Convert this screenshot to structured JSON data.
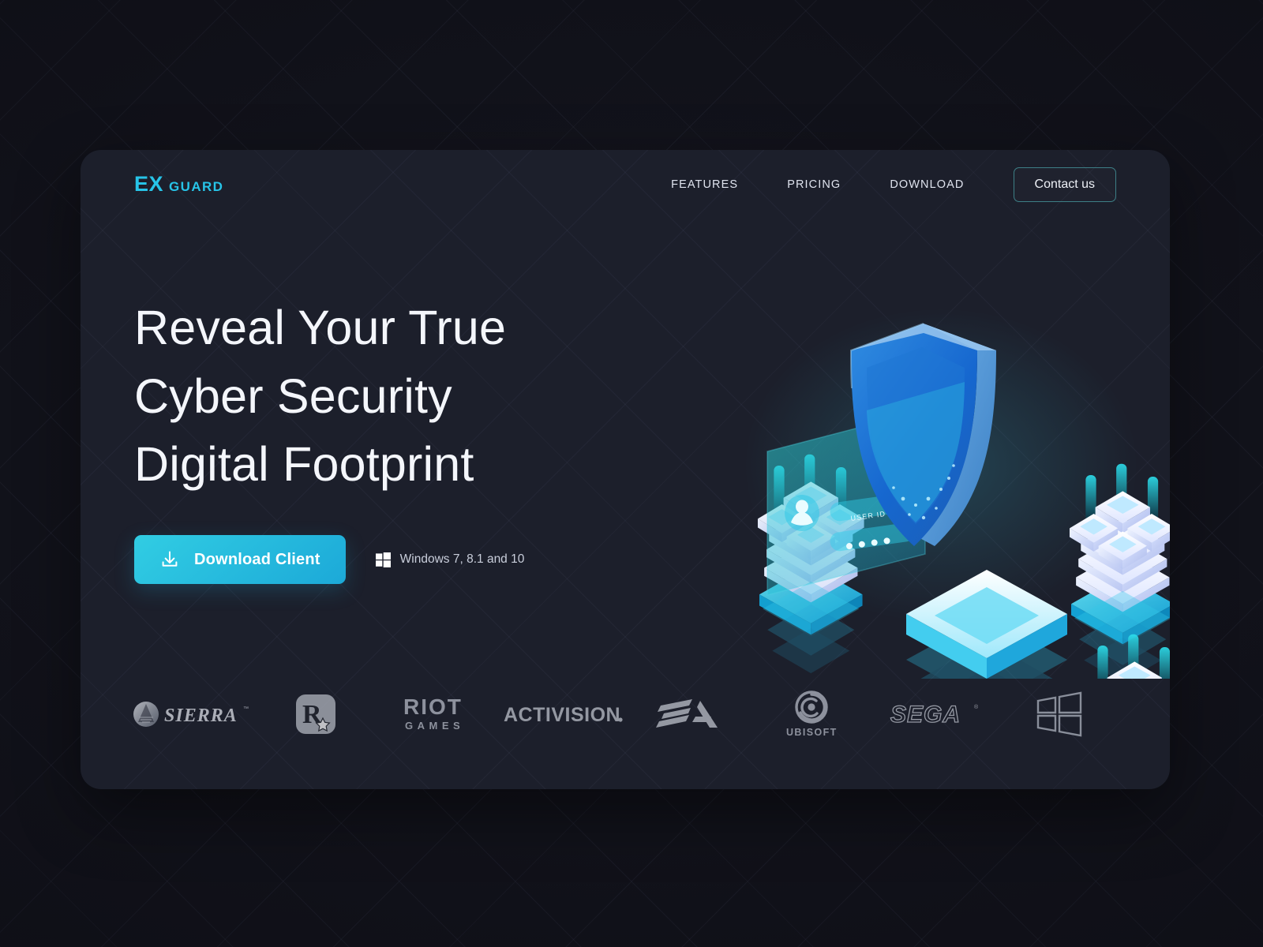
{
  "brand": {
    "name_primary": "EX",
    "name_secondary": "GUARD",
    "accent_color": "#27c4e8"
  },
  "nav": {
    "links": [
      {
        "label": "FEATURES"
      },
      {
        "label": "PRICING"
      },
      {
        "label": "DOWNLOAD"
      }
    ],
    "cta": {
      "label": "Contact us",
      "border_color": "#3d7f86"
    }
  },
  "hero": {
    "headline_lines": [
      "Reveal Your True",
      "Cyber Security",
      "Digital Footprint"
    ],
    "download_button": {
      "label": "Download Client",
      "icon": "download-icon",
      "gradient_from": "#31cde3",
      "gradient_to": "#1ca9d8"
    },
    "os_note": {
      "icon": "windows-icon",
      "text": "Windows 7, 8.1 and 10"
    },
    "illustration": {
      "shield_label": "shield-3d",
      "login_card": {
        "avatar": "user-avatar-icon",
        "username_placeholder": "USER ID",
        "password_dots": 4
      },
      "server_stacks": 3
    }
  },
  "partners": [
    {
      "name": "SIERRA",
      "icon": "sierra-logo"
    },
    {
      "name": "Rockstar Games",
      "icon": "rockstar-logo"
    },
    {
      "name": "RIOT GAMES",
      "icon": "riot-games-logo",
      "line1": "RIOT",
      "line2": "GAMES"
    },
    {
      "name": "ACTIVISION",
      "icon": "activision-logo"
    },
    {
      "name": "EA",
      "icon": "ea-logo"
    },
    {
      "name": "UBISOFT",
      "icon": "ubisoft-logo"
    },
    {
      "name": "SEGA",
      "icon": "sega-logo"
    },
    {
      "name": "Windows",
      "icon": "windows-outline-logo"
    }
  ],
  "theme": {
    "page_background": "#15161f",
    "card_background": "#1c1f2b",
    "headline_color": "#f4f6fb",
    "muted_text": "#c9cedb"
  }
}
